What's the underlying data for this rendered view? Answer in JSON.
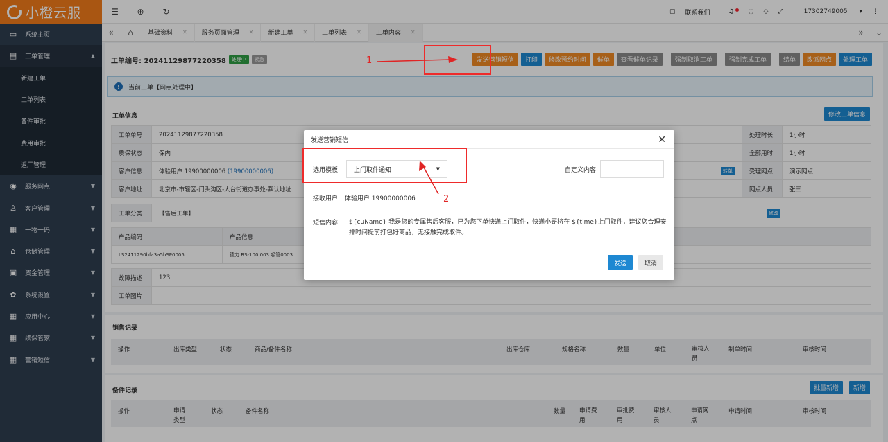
{
  "app": {
    "logo": "小橙云服"
  },
  "sidebar": {
    "items": [
      {
        "label": "系统主页",
        "icon": "monitor-icon"
      },
      {
        "label": "工单管理",
        "icon": "document-icon",
        "expanded": true
      },
      {
        "label": "服务网点",
        "icon": "globe-icon"
      },
      {
        "label": "客户管理",
        "icon": "user-icon"
      },
      {
        "label": "一物一码",
        "icon": "grid-icon"
      },
      {
        "label": "仓储管理",
        "icon": "bank-icon"
      },
      {
        "label": "资金管理",
        "icon": "cash-icon"
      },
      {
        "label": "系统设置",
        "icon": "gear-icon"
      },
      {
        "label": "应用中心",
        "icon": "grid-icon"
      },
      {
        "label": "续保管家",
        "icon": "grid-icon"
      },
      {
        "label": "营销短信",
        "icon": "grid-icon"
      }
    ],
    "submenu": [
      "新建工单",
      "工单列表",
      "备件审批",
      "费用审批",
      "返厂管理"
    ]
  },
  "topbar": {
    "contact": "联系我们",
    "user": "17302749005"
  },
  "tabs": [
    "基础资料",
    "服务页面管理",
    "新建工单",
    "工单列表",
    "工单内容"
  ],
  "order": {
    "no_label": "工单编号:",
    "no": "20241129877220358",
    "status": "处理中",
    "urgent": "紧急",
    "buttons": [
      "发送营销短信",
      "打印",
      "修改预约时间",
      "催单",
      "查看催单记录",
      "强制取消工单",
      "强制完成工单",
      "结单",
      "改派网点",
      "处理工单"
    ],
    "alert": "当前工单【网点处理中】"
  },
  "info": {
    "title": "工单信息",
    "edit_btn": "修改工单信息",
    "rows": [
      {
        "l1": "工单单号",
        "v1": "20241129877220358",
        "l2": "处理时长",
        "v2": "1小时"
      },
      {
        "l1": "质保状态",
        "v1": "保内",
        "l2": "全部用时",
        "v2": "1小时"
      },
      {
        "l1": "客户信息",
        "v1": "体验用户   19900000006",
        "v1b": "(19900000006)",
        "l2": "受理网点",
        "v2": "演示网点",
        "tag": "转单"
      },
      {
        "l1": "客户地址",
        "v1": "北京市-市辖区-门头沟区-大台街道办事处-默认地址",
        "l2": "网点人员",
        "v2": "张三"
      }
    ],
    "cat_label": "工单分类",
    "cat_value": "【售后工单】",
    "cat_edit": "修改",
    "prod_headers": [
      "产品编码",
      "产品信息"
    ],
    "prod_row": [
      "LS2411290bfa3a5bSP0005",
      "德力 RS-100 003 吸管0003"
    ],
    "fault_label": "故障描述",
    "fault_value": "123",
    "img_label": "工单图片"
  },
  "sales": {
    "title": "销售记录",
    "headers": [
      "操作",
      "出库类型",
      "状态",
      "商品/备件名称",
      "出库仓库",
      "规格名称",
      "数量",
      "单位",
      "审核人员",
      "制单时间",
      "审核时间"
    ]
  },
  "parts": {
    "title": "备件记录",
    "btn_batch": "批量新增",
    "btn_new": "新增",
    "headers": [
      "操作",
      "申请类型",
      "状态",
      "备件名称",
      "数量",
      "申请费用",
      "审批费用",
      "审核人员",
      "申请网点",
      "申请时间",
      "审核时间"
    ]
  },
  "dialog": {
    "title": "发送营销短信",
    "template_label": "选用模板",
    "template_value": "上门取件通知",
    "custom_label": "自定义内容",
    "receiver_label": "接收用户:",
    "receiver_value": "体验用户 19900000006",
    "content_label": "短信内容:",
    "content_value": "${cuName} 我是您的专属售后客服，已为您下单快递上门取件，快递小哥将在 ${time}上门取件，建议您合理安排时间提前打包好商品，无接触完成取件。",
    "send": "发送",
    "cancel": "取消"
  },
  "annotations": {
    "n1": "1",
    "n2": "2"
  }
}
